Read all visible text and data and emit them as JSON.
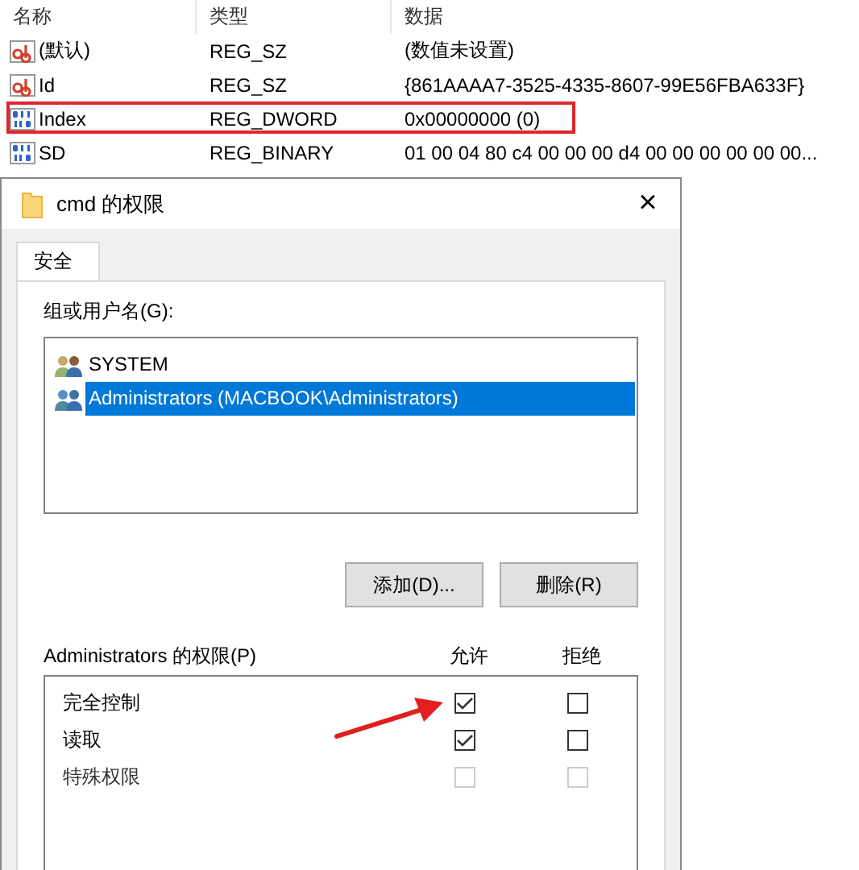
{
  "registry": {
    "columns": [
      "名称",
      "类型",
      "数据"
    ],
    "rows": [
      {
        "kind": "string",
        "name": "(默认)",
        "type": "REG_SZ",
        "data": "(数值未设置)",
        "highlighted": false
      },
      {
        "kind": "string",
        "name": "Id",
        "type": "REG_SZ",
        "data": "{861AAAA7-3525-4335-8607-99E56FBA633F}",
        "highlighted": false
      },
      {
        "kind": "binary",
        "name": "Index",
        "type": "REG_DWORD",
        "data": "0x00000000 (0)",
        "highlighted": true
      },
      {
        "kind": "binary",
        "name": "SD",
        "type": "REG_BINARY",
        "data": "01 00 04 80 c4 00 00 00 d4 00 00 00 00 00 00...",
        "highlighted": false
      }
    ]
  },
  "dialog": {
    "title": "cmd 的权限",
    "close": "×",
    "tabs": [
      {
        "label": "安全",
        "selected": true
      }
    ],
    "group_label": "组或用户名(G):",
    "users": [
      {
        "kind": "system",
        "name": "SYSTEM",
        "selected": false
      },
      {
        "kind": "admins",
        "name": "Administrators (MACBOOK\\Administrators)",
        "selected": true
      }
    ],
    "buttons": [
      "添加(D)...",
      "删除(R)"
    ],
    "permissions_label": "Administrators 的权限(P)",
    "allow_header": "允许",
    "deny_header": "拒绝",
    "permissions": [
      {
        "name": "完全控制",
        "allow": true,
        "deny": false,
        "disabled": false
      },
      {
        "name": "读取",
        "allow": true,
        "deny": false,
        "disabled": false
      },
      {
        "name": "特殊权限",
        "allow": false,
        "deny": false,
        "disabled": true
      }
    ],
    "arrow_annotation": true
  }
}
